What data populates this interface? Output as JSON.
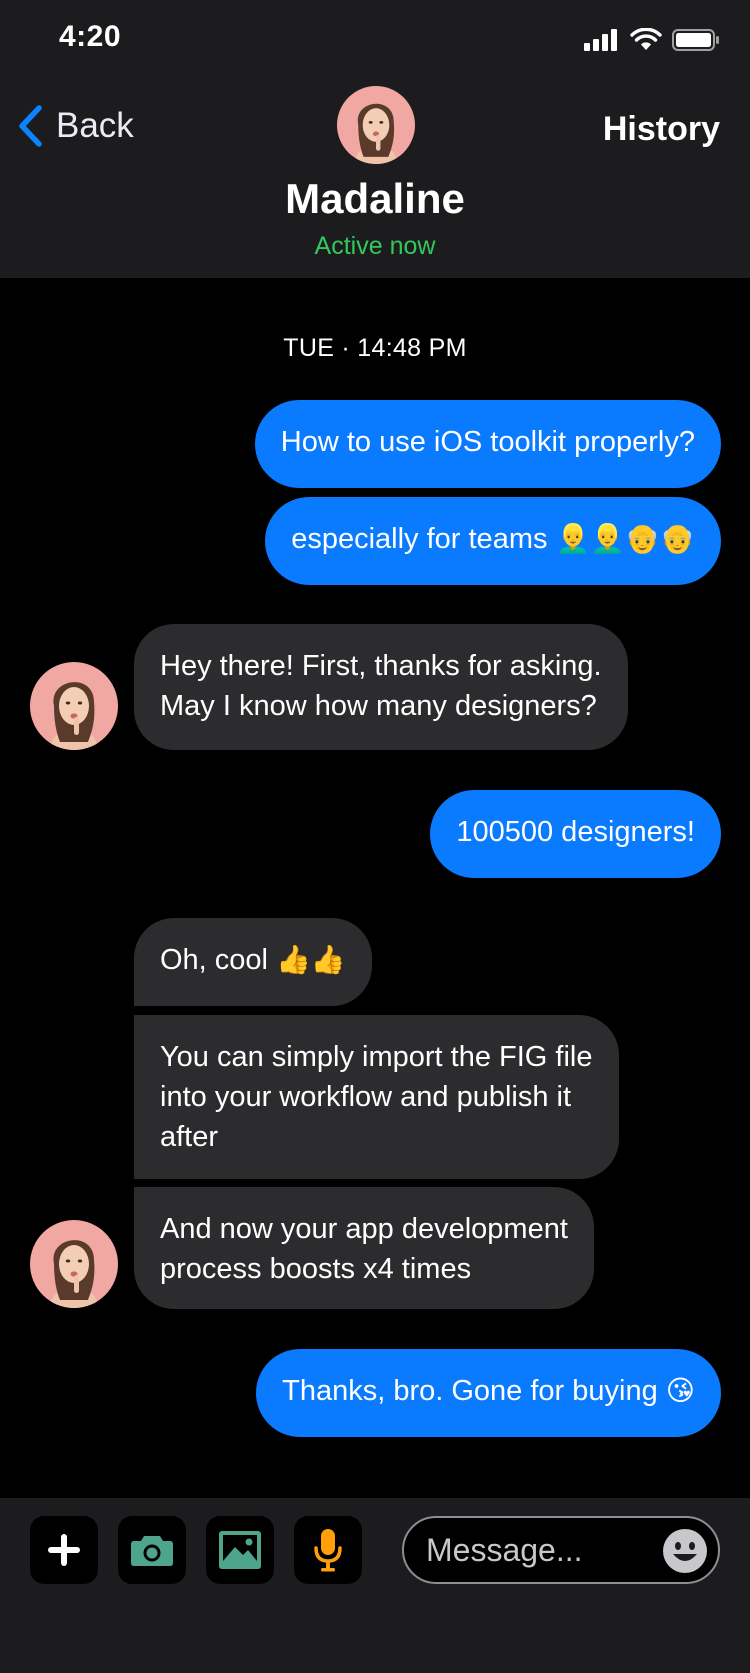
{
  "status_bar": {
    "time": "4:20"
  },
  "nav": {
    "back_label": "Back",
    "history_label": "History",
    "contact_name": "Madaline",
    "contact_status": "Active now"
  },
  "chat": {
    "day_label": "TUE · 14:48 PM",
    "messages": [
      {
        "text": "How to use iOS toolkit properly?"
      },
      {
        "text": "especially for teams",
        "emoji": "👱‍♂️👱‍♂️👴👴"
      },
      {
        "lines": [
          "Hey there! First, thanks for asking.",
          "May I know how many designers?"
        ]
      },
      {
        "text": "100500 designers!"
      },
      {
        "text": "Oh, cool",
        "emoji": "👍👍"
      },
      {
        "lines": [
          "You can simply import the FIG file",
          "into your workflow and publish it",
          "after"
        ]
      },
      {
        "lines": [
          "And now your app development",
          "process boosts x4 times"
        ]
      },
      {
        "text": "Thanks, bro. Gone for buying",
        "emoji": "😘"
      }
    ]
  },
  "composer": {
    "placeholder": "Message...",
    "icons": [
      "plus-icon",
      "camera-icon",
      "image-icon",
      "microphone-icon",
      "emoji-icon"
    ],
    "accent_colors": {
      "camera": "#4fa58c",
      "image": "#4fa58c",
      "mic": "#ff9f0a"
    }
  },
  "colors": {
    "outgoing_bubble": "#0a7aff",
    "incoming_bubble": "#2c2c2e",
    "active_status": "#34c759",
    "header_bg": "#1c1c1e"
  }
}
